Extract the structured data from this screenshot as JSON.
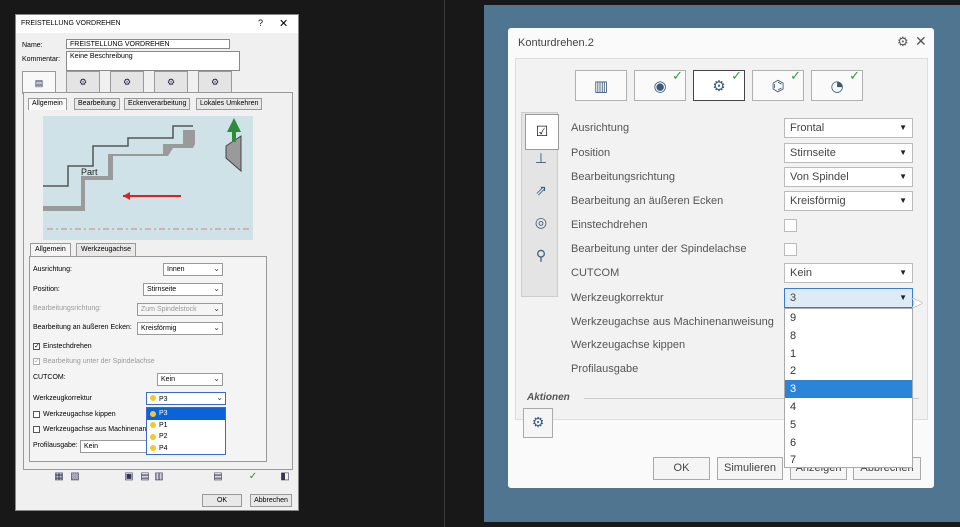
{
  "left_dialog": {
    "title": "FREISTELLUNG VORDREHEN",
    "help": "?",
    "close": "✕",
    "name_label": "Name:",
    "name_value": "FREISTELLUNG VORDREHEN",
    "comment_label": "Kommentar:",
    "comment_value": "Keine Beschreibung",
    "top_tabs": [
      "▤",
      "⚙",
      "⚙",
      "⚙",
      "⚙"
    ],
    "sub_tabs": [
      "Allgemein",
      "Bearbeitung",
      "Eckenverarbeitung",
      "Lokales Umkehren"
    ],
    "picture_label": "Part",
    "inner_tabs": [
      "Allgemein",
      "Werkzeugachse"
    ],
    "fields": [
      {
        "label": "Ausrichtung:",
        "value": "Innen"
      },
      {
        "label": "Position:",
        "value": "Stirnseite"
      },
      {
        "label": "Bearbeitungsrichtung:",
        "value": "Zum Spindelstock"
      },
      {
        "label": "Bearbeitung an äußeren Ecken:",
        "value": "Kreisförmig"
      }
    ],
    "check_einstech": "Einstechdrehen",
    "check_unter": "Bearbeitung unter der Spindelachse",
    "cutcom_label": "CUTCOM:",
    "cutcom_value": "Kein",
    "wk_label": "Werkzeugkorrektur",
    "wk_value": "P3",
    "check_kippen": "Werkzeugachse kippen",
    "check_machine": "Werkzeugachse aus Machinenan",
    "profil_label": "Profilausgabe:",
    "profil_value": "Kein",
    "wk_options": [
      "P3",
      "P1",
      "P2",
      "P4"
    ],
    "ok": "OK",
    "cancel": "Abbrechen"
  },
  "right_dialog": {
    "title": "Konturdrehen.2",
    "rows": [
      {
        "label": "Ausrichtung",
        "value": "Frontal"
      },
      {
        "label": "Position",
        "value": "Stirnseite"
      },
      {
        "label": "Bearbeitungsrichtung",
        "value": "Von Spindel"
      },
      {
        "label": "Bearbeitung an äußeren Ecken",
        "value": "Kreisförmig"
      },
      {
        "label": "Einstechdrehen",
        "value": ""
      },
      {
        "label": "Bearbeitung unter der Spindelachse",
        "value": ""
      },
      {
        "label": "CUTCOM",
        "value": "Kein"
      },
      {
        "label": "Werkzeugkorrektur",
        "value": "3"
      },
      {
        "label": "Werkzeugachse aus Machinenanweisung",
        "value": ""
      },
      {
        "label": "Werkzeugachse kippen",
        "value": ""
      },
      {
        "label": "Profilausgabe",
        "value": ""
      }
    ],
    "wk_options": [
      "9",
      "8",
      "1",
      "2",
      "3",
      "4",
      "5",
      "6",
      "7"
    ],
    "aktionen": "Aktionen",
    "ok": "OK",
    "simulate": "Simulieren",
    "show": "Anzeigen",
    "cancel": "Abbrechen"
  }
}
